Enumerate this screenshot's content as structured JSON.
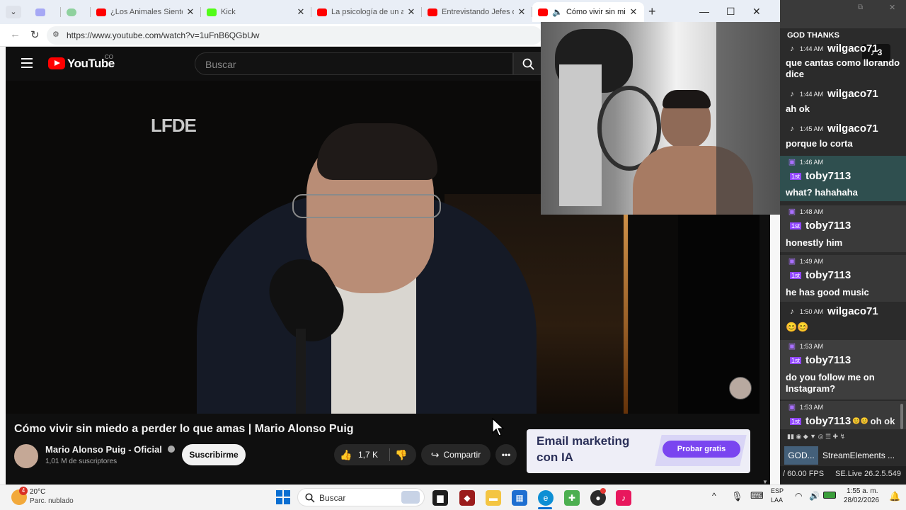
{
  "browser": {
    "tabs": [
      {
        "title": ""
      },
      {
        "title": ""
      },
      {
        "title": "¿Los Animales Sienten A"
      },
      {
        "title": "Kick"
      },
      {
        "title": "La psicología de un adic"
      },
      {
        "title": "Entrevistando Jefes de N"
      },
      {
        "title": "Cómo vivir sin mied"
      }
    ],
    "new_tab": "+",
    "url": "https://www.youtube.com/watch?v=1uFnB6QGbUw",
    "colors": {
      "youtube_red": "#ff0000",
      "kick_green": "#53fc18"
    }
  },
  "youtube": {
    "logo": "YouTube",
    "region": "CO",
    "search_placeholder": "Buscar",
    "video_watermark": "LFDE",
    "video_title": "Cómo vivir sin miedo a perder lo que amas | Mario Alonso Puig",
    "channel_name": "Mario Alonso Puig - Oficial",
    "subscribers": "1,01 M de suscriptores",
    "subscribe_label": "Suscribirme",
    "likes": "1,7 K",
    "share_label": "Compartir",
    "ad_title_1": "Email marketing",
    "ad_title_2": "con IA",
    "ad_button": "Probar gratis"
  },
  "chat": {
    "header": "GOD THANKS",
    "messages": [
      {
        "platform": "tiktok",
        "time": "1:44 AM",
        "user": "wilgaco71",
        "text": "que cantas como llorando dice"
      },
      {
        "platform": "tiktok",
        "time": "1:44 AM",
        "user": "wilgaco71",
        "text": "ah ok"
      },
      {
        "platform": "tiktok",
        "time": "1:45 AM",
        "user": "wilgaco71",
        "text": "porque lo corta"
      },
      {
        "platform": "twitch",
        "time": "1:46 AM",
        "user": "toby7113",
        "text": "what? hahahaha"
      },
      {
        "platform": "twitch",
        "time": "1:48 AM",
        "user": "toby7113",
        "text": "honestly him"
      },
      {
        "platform": "twitch",
        "time": "1:49 AM",
        "user": "toby7113",
        "text": "he has good music"
      },
      {
        "platform": "tiktok",
        "time": "1:50 AM",
        "user": "wilgaco71",
        "text": "😊😊"
      },
      {
        "platform": "twitch",
        "time": "1:53 AM",
        "user": "toby7113",
        "text": "do you follow me on Instagram?"
      },
      {
        "platform": "twitch",
        "time": "1:53 AM",
        "user": "toby7113",
        "text": "oh ok"
      }
    ],
    "viewer_count": "3",
    "first_badge": "1st",
    "tab_1": "GOD...",
    "tab_2": "StreamElements ...",
    "fps": "/ 60.00 FPS",
    "version": "SE.Live 26.2.5.549"
  },
  "taskbar": {
    "weather_temp": "20°C",
    "weather_desc": "Parc. nublado",
    "weather_badge": "4",
    "search_label": "Buscar",
    "lang_1": "ESP",
    "lang_2": "LAA",
    "time": "1:55 a. m.",
    "date": "28/02/2026"
  }
}
